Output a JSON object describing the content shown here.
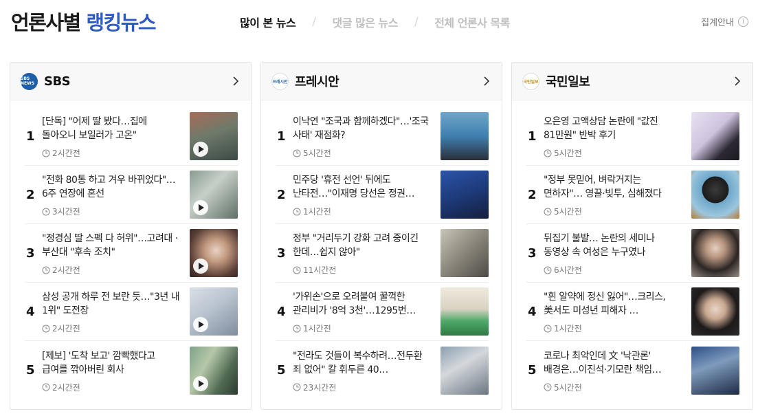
{
  "header": {
    "brand_part1": "언론사별",
    "brand_part2": "랭킹뉴스",
    "tabs": [
      {
        "label": "많이 본 뉴스"
      },
      {
        "label": "댓글 많은 뉴스"
      },
      {
        "label": "전체 언론사 목록"
      }
    ],
    "info_label": "집계안내",
    "info_icon": "i"
  },
  "columns": [
    {
      "press": "SBS",
      "logo_text": "SBS NEWS",
      "items": [
        {
          "rank": "1",
          "title": "[단독] \"어제 딸 봤다…집에 돌아오니 보일러가 고온\"",
          "time": "2시간전",
          "video": true
        },
        {
          "rank": "2",
          "title": "\"전화 80통 하고 겨우 바뀌었다\"…6주 연장에 혼선",
          "time": "3시간전",
          "video": true
        },
        {
          "rank": "3",
          "title": "\"정경심 딸 스펙 다 허위\"…고려대 · 부산대 \"후속 조치\"",
          "time": "2시간전",
          "video": true
        },
        {
          "rank": "4",
          "title": "삼성 공개 하루 전 보란 듯…\"3년 내 1위\" 도전장",
          "time": "2시간전",
          "video": true
        },
        {
          "rank": "5",
          "title": "[제보] '도착 보고' 깜빡했다고 급여를 깎아버린 회사",
          "time": "2시간전",
          "video": true
        }
      ]
    },
    {
      "press": "프레시안",
      "logo_text": "프레시안",
      "items": [
        {
          "rank": "1",
          "title": "이낙연 \"조국과 함께하겠다\"…'조국 사태' 재점화?",
          "time": "5시간전",
          "video": false
        },
        {
          "rank": "2",
          "title": "민주당 '휴전 선언' 뒤에도 난타전…\"이재명 당선은 정권…",
          "time": "1시간전",
          "video": false
        },
        {
          "rank": "3",
          "title": "정부 \"거리두기 강화 고려 중이긴 한데…쉽지 않아\"",
          "time": "11시간전",
          "video": false
        },
        {
          "rank": "4",
          "title": "'가위손'으로 오려붙여 꿀꺽한 관리비가 '8억 3천'…1295번…",
          "time": "1시간전",
          "video": false
        },
        {
          "rank": "5",
          "title": "\"전라도 것들이 복수하려…전두환 죄 없어\" 칼 휘두른 40…",
          "time": "23시간전",
          "video": false
        }
      ]
    },
    {
      "press": "국민일보",
      "logo_text": "국민일보",
      "items": [
        {
          "rank": "1",
          "title": "오은영 고액상담 논란에 \"값진 81만원\" 반박 후기",
          "time": "5시간전",
          "video": false
        },
        {
          "rank": "2",
          "title": "\"정부 못믿어, 벼락거지는 면하자\"… 영끌·빚투, 심해졌다",
          "time": "5시간전",
          "video": false
        },
        {
          "rank": "3",
          "title": "뒤집기 불발… 논란의 세미나 동영상 속 여성은 누구였나",
          "time": "6시간전",
          "video": false
        },
        {
          "rank": "4",
          "title": "\"흰 알약에 정신 잃어\"…크리스, 美서도 미성년 피해자 …",
          "time": "1시간전",
          "video": false
        },
        {
          "rank": "5",
          "title": "코로나 최악인데 文 '낙관론' 배경은…이진석·기모란 책임…",
          "time": "5시간전",
          "video": false
        }
      ]
    }
  ],
  "colors": {
    "brand_blue": "#2f59c4",
    "active_tab": "#111111",
    "inactive_tab": "#c0c0c0",
    "time_gray": "#777777",
    "border": "#e3e3e3"
  }
}
